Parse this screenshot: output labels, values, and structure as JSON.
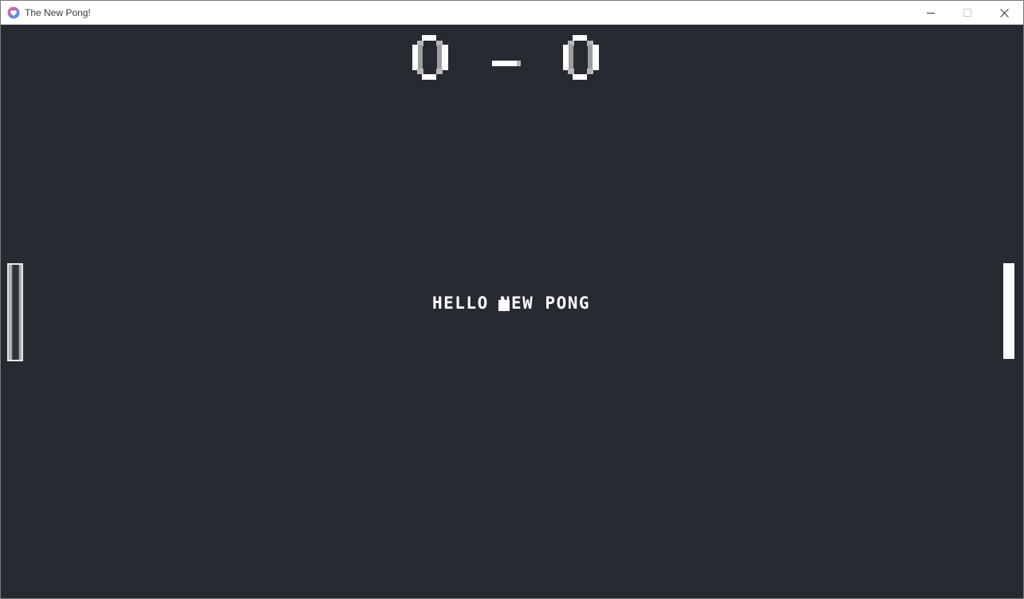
{
  "window": {
    "title": "The New Pong!",
    "controls": {
      "minimize": "minimize-icon",
      "maximize": "maximize-icon",
      "close": "close-icon"
    }
  },
  "game": {
    "score_left": "0",
    "score_right": "0",
    "score_separator": "-",
    "message": "HELLO NEW PONG",
    "colors": {
      "background": "#262a31",
      "foreground": "#ffffff"
    }
  }
}
